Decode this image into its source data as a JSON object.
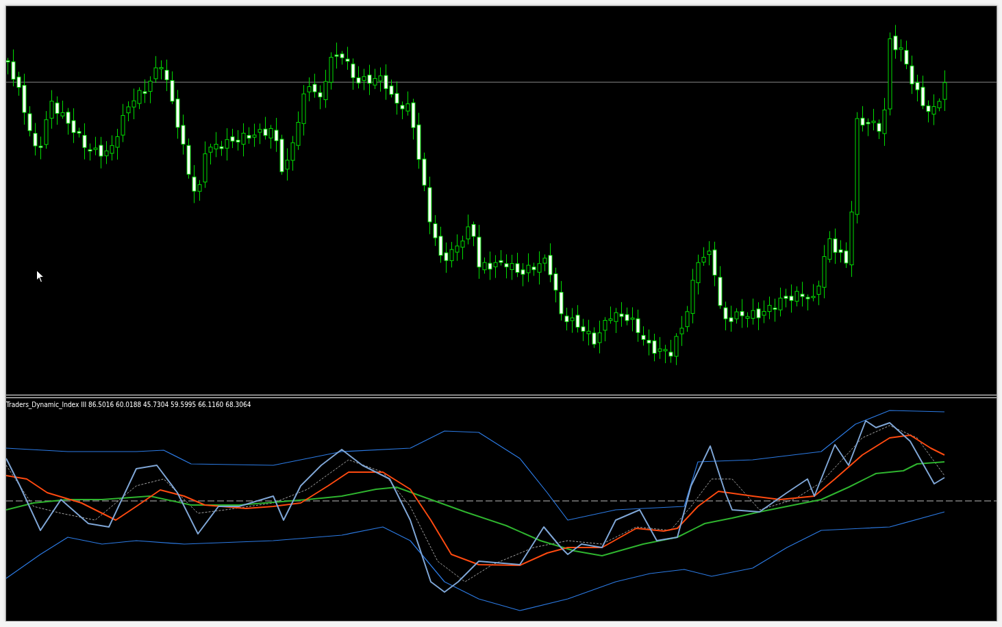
{
  "indicator_panel": {
    "label": "Traders_Dynamic_Index III 86.5016 60.0188 45.7304 59.5995 66.1160 68.3064"
  }
}
